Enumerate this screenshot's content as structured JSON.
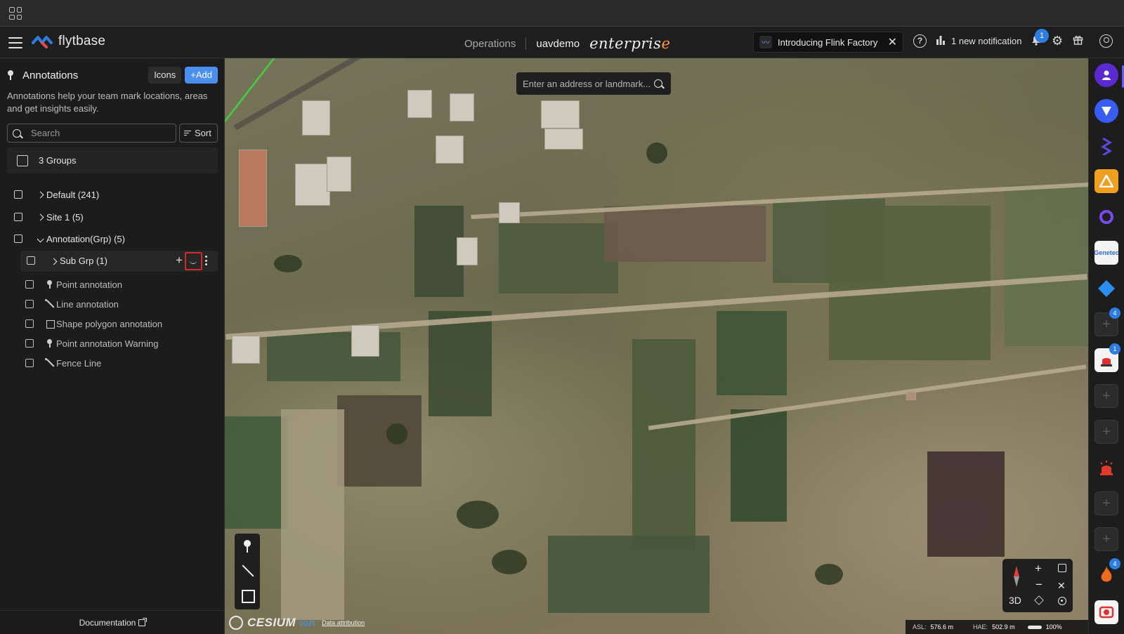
{
  "header": {
    "logo_text": "flytbase",
    "nav_operations": "Operations",
    "org_name": "uavdemo",
    "edition_main": "enterpris",
    "edition_last": "e",
    "promo_text": "Introducing Flink Factory",
    "promo_close": "✕",
    "help_glyph": "?",
    "notification_text": "1 new notification",
    "notification_count": "1",
    "colors": {
      "brand_blue": "#2e7de0",
      "accent_orange": "#ff9d3b"
    }
  },
  "sidebar": {
    "title": "Annotations",
    "icons_button": "Icons",
    "add_button": "+Add",
    "description": "Annotations help your team mark locations, areas and get insights easily.",
    "search_placeholder": "Search",
    "sort_label": "Sort",
    "groups_summary": "3 Groups",
    "groups": [
      {
        "label": "Default (241)",
        "expanded": false
      },
      {
        "label": "Site 1 (5)",
        "expanded": false
      },
      {
        "label": "Annotation(Grp) (5)",
        "expanded": true
      }
    ],
    "subgroup": {
      "label": "Sub Grp (1)",
      "add_glyph": "+"
    },
    "items": [
      {
        "label": "Point annotation",
        "icon": "pin-icon"
      },
      {
        "label": "Line annotation",
        "icon": "line-icon"
      },
      {
        "label": "Shape polygon annotation",
        "icon": "polygon-icon"
      },
      {
        "label": "Point annotation Warning",
        "icon": "pin-icon"
      },
      {
        "label": "Fence Line",
        "icon": "line-icon"
      }
    ],
    "footer_link": "Documentation"
  },
  "map": {
    "search_placeholder": "Enter an address or landmark...",
    "cesium_word": "CESIUM",
    "cesium_ion": "ion",
    "attribution": "Data attribution",
    "view_mode": "3D",
    "zoom_in": "+",
    "zoom_out": "−",
    "expand_glyph": "✕",
    "asl_label": "ASL:",
    "asl_value": "576.6 m",
    "hae_label": "HAE:",
    "hae_value": "502.9 m",
    "zoom_level": "100%"
  },
  "rightbar": {
    "badges": [
      "4",
      "1",
      "4"
    ],
    "app_label_genetec": "Genetec"
  }
}
